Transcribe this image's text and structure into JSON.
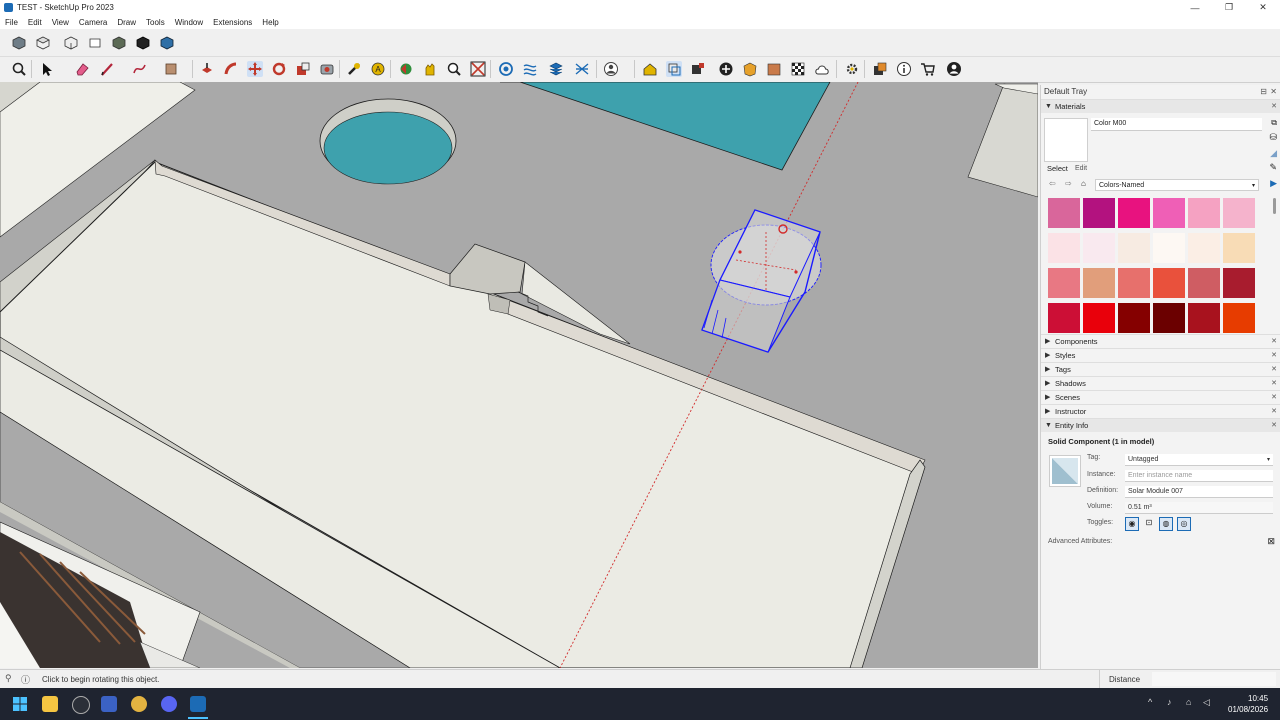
{
  "window": {
    "title": "TEST - SketchUp Pro 2023",
    "controls": [
      "—",
      "❐",
      "✕"
    ]
  },
  "menu": [
    "File",
    "Edit",
    "View",
    "Camera",
    "Draw",
    "Tools",
    "Window",
    "Extensions",
    "Help"
  ],
  "tray": {
    "title": "Default Tray",
    "materials": {
      "section_label": "Materials",
      "material_name": "Color M00",
      "tab_select": "Select",
      "tab_edit": "Edit",
      "collection": "Colors-Named",
      "swatches": [
        "#d9669b",
        "#b3127f",
        "#e8127f",
        "#ef5fb6",
        "#f5a2c2",
        "#f5b3cc",
        "#fbe2e6",
        "#f9e9ef",
        "#f7ebe2",
        "#fdf8f3",
        "#fbeee5",
        "#f8dcb6",
        "#e87883",
        "#e19e7b",
        "#e7706c",
        "#e9513c",
        "#cf5d63",
        "#a81c2e",
        "#cc0f36",
        "#e9000b",
        "#850000",
        "#6b0000",
        "#a8121e",
        "#e73c00"
      ]
    },
    "panels": [
      "Components",
      "Styles",
      "Tags",
      "Shadows",
      "Scenes",
      "Instructor"
    ],
    "entity_info": {
      "section_label": "Entity Info",
      "heading": "Solid Component (1 in model)",
      "tag_label": "Tag:",
      "tag_value": "Untagged",
      "instance_label": "Instance:",
      "instance_placeholder": "Enter instance name",
      "definition_label": "Definition:",
      "definition_value": "Solar Module 007",
      "volume_label": "Volume:",
      "volume_value": "0.51 m³",
      "toggles_label": "Toggles:",
      "advanced_label": "Advanced Attributes:"
    }
  },
  "status": {
    "message": "Click to begin rotating this object.",
    "measure_label": "Distance"
  },
  "taskbar": {
    "time": "10:45",
    "date": "01/08/2026"
  },
  "colors": {
    "viewport_bg": "#a9a9a9",
    "pool_teal": "#3ea1ad",
    "slab_face": "#ebebe4",
    "selection_blue": "#1a1aff",
    "axis_red": "#d22a2a"
  }
}
